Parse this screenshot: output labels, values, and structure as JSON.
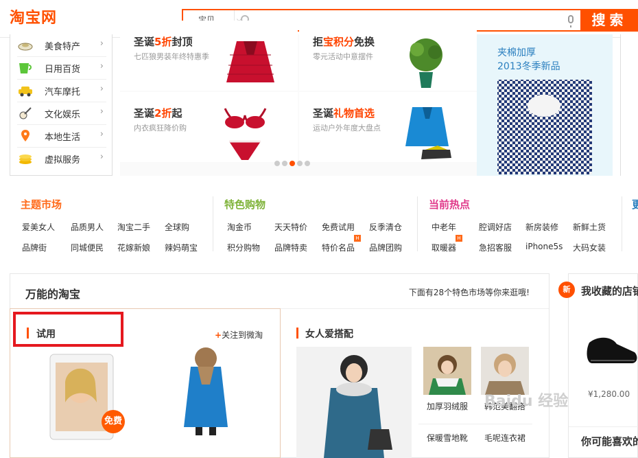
{
  "header": {
    "logo": "淘宝网",
    "search": {
      "category": "宝贝",
      "placeholder": "",
      "button": "搜索"
    }
  },
  "category_menu": [
    {
      "label": "美食特产",
      "icon": "food-icon"
    },
    {
      "label": "日用百货",
      "icon": "cup-icon"
    },
    {
      "label": "汽车摩托",
      "icon": "car-icon"
    },
    {
      "label": "文化娱乐",
      "icon": "guitar-icon"
    },
    {
      "label": "本地生活",
      "icon": "location-pin-icon"
    },
    {
      "label": "虚拟服务",
      "icon": "coins-icon"
    }
  ],
  "banner": {
    "cells": [
      {
        "title_pre": "圣诞",
        "title_hl": "5折",
        "title_post": "封顶",
        "sub": "七匹狼男装年终特惠季"
      },
      {
        "title_pre": "拒",
        "title_hl": "宝积分",
        "title_post": "免换",
        "sub": "零元活动中意摆件"
      },
      {
        "title_pre": "圣诞",
        "title_hl": "2折",
        "title_post": "起",
        "sub": "内衣疯狂降价购"
      },
      {
        "title_pre": "圣诞",
        "title_hl": "礼物首选",
        "title_post": "",
        "sub": "运动户外年度大盘点"
      }
    ],
    "dots": 5,
    "active_dot": 3,
    "promo": {
      "line1": "夹棉加厚",
      "line2": "2013冬季新品"
    }
  },
  "markets": [
    {
      "heading": "主题市场",
      "color": "#ff6a1a",
      "links": [
        "爱美女人",
        "品质男人",
        "淘宝二手",
        "全球购",
        "品牌街",
        "同城便民",
        "花嫁新娘",
        "辣妈萌宝"
      ]
    },
    {
      "heading": "特色购物",
      "color": "#7fb33a",
      "links": [
        "淘金币",
        "天天特价",
        "免费试用",
        "反季清仓",
        "积分购物",
        "品牌特卖",
        "特价名品",
        "品牌团购"
      ]
    },
    {
      "heading": "当前热点",
      "color": "#e0398a",
      "links": [
        "中老年",
        "腔调好店",
        "新房装修",
        "新鲜土货",
        "取暖器",
        "急招客服",
        "iPhone5s",
        "大码女装"
      ]
    },
    {
      "heading": "更",
      "color": "#2a7fbf",
      "links": []
    }
  ],
  "wanneng": {
    "title": "万能的淘宝",
    "more": "下面有28个特色市场等你来逛哦!",
    "trial": {
      "label": "试用",
      "follow": "关注到微淘",
      "free_badge": "免费"
    },
    "women": {
      "label": "女人爱搭配",
      "items": [
        "加厚羽绒服",
        "韩范美翻搭",
        "保暖雪地靴",
        "毛呢连衣裙"
      ]
    }
  },
  "favorites": {
    "badge": "新",
    "title": "我收藏的店铺",
    "price": "¥1,280.00",
    "guess": "你可能喜欢的"
  },
  "watermark": "Baidu 经验",
  "colors": {
    "accent": "#ff5000",
    "red_box": "#e5181e"
  }
}
